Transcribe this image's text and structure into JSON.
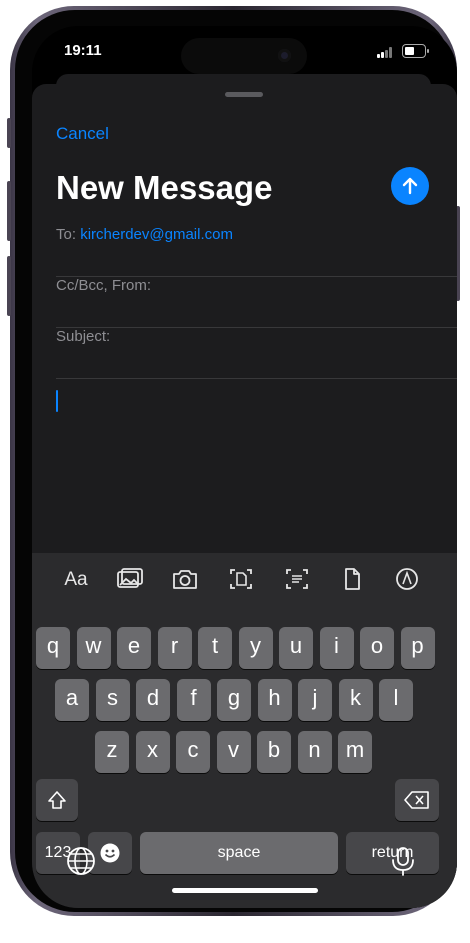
{
  "status_bar": {
    "time": "19:11"
  },
  "compose": {
    "cancel_label": "Cancel",
    "title": "New Message",
    "to_label": "To:",
    "to_value": "kircherdev@gmail.com",
    "cc_label": "Cc/Bcc, From:",
    "subject_label": "Subject:"
  },
  "keyboard": {
    "toolbar": {
      "format_label": "Aa",
      "icons": [
        "photo-library-icon",
        "camera-icon",
        "scan-document-icon",
        "scan-text-icon",
        "attach-file-icon",
        "markup-icon"
      ]
    },
    "rows": [
      [
        "q",
        "w",
        "e",
        "r",
        "t",
        "y",
        "u",
        "i",
        "o",
        "p"
      ],
      [
        "a",
        "s",
        "d",
        "f",
        "g",
        "h",
        "j",
        "k",
        "l"
      ],
      [
        "z",
        "x",
        "c",
        "v",
        "b",
        "n",
        "m"
      ]
    ],
    "numbers_label": "123",
    "space_label": "space",
    "return_label": "return"
  },
  "colors": {
    "accent": "#0a84ff",
    "sheet": "#1c1c1e",
    "key": "#6b6b6e",
    "key_dark": "#47474a"
  }
}
